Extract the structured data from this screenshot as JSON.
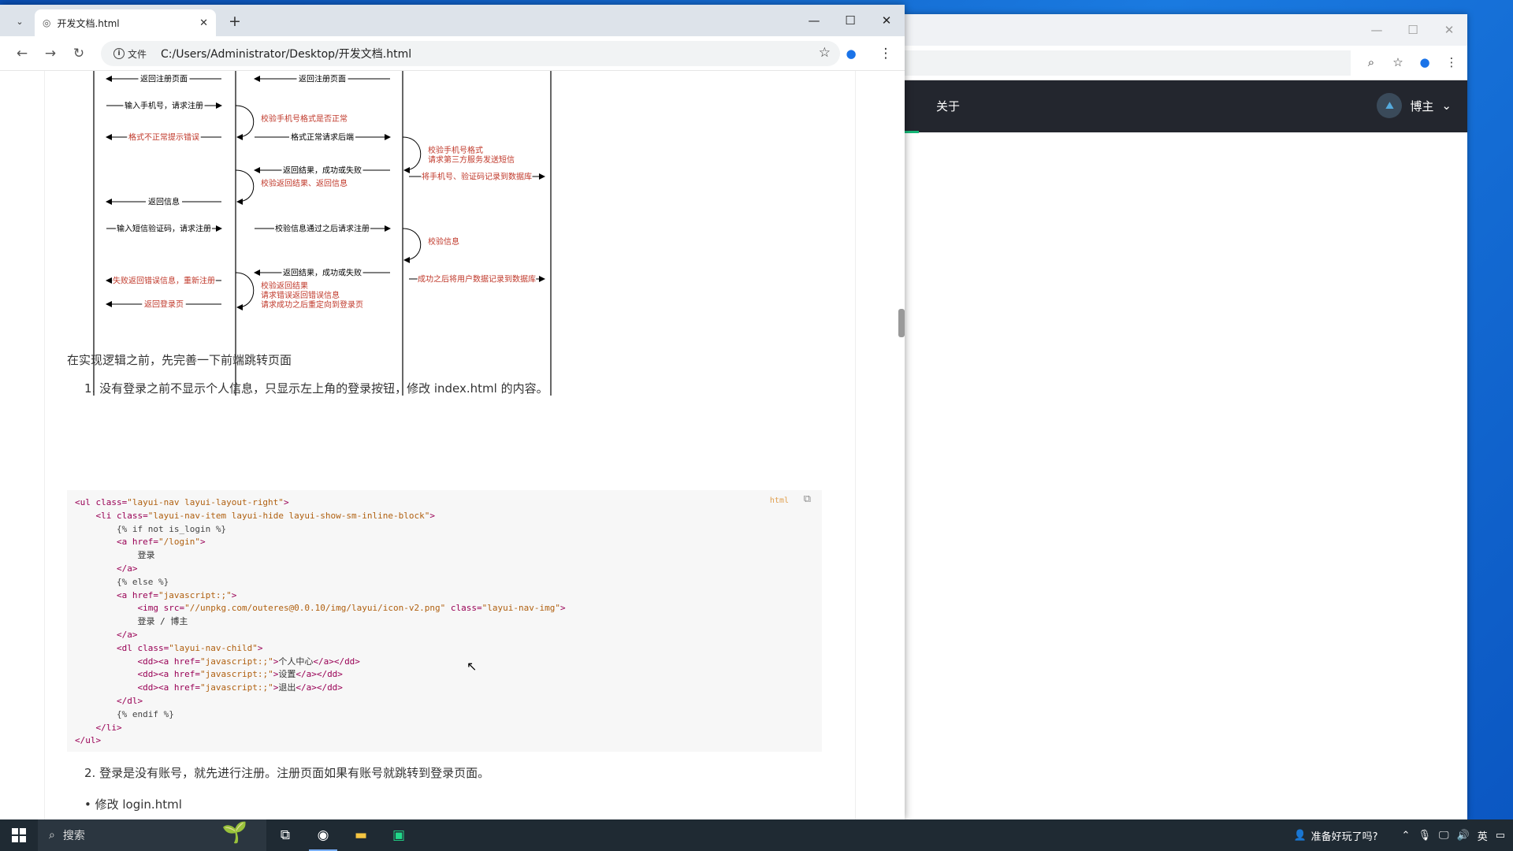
{
  "front_window": {
    "tab_title": "开发文档.html",
    "address_prefix": "文件",
    "url": "C:/Users/Administrator/Desktop/开发文档.html"
  },
  "back_window": {
    "nav_about": "关于",
    "user_label": "博主"
  },
  "diagram": {
    "col1": [
      {
        "text": "返回注册页面",
        "dir": "left",
        "color": "black"
      },
      {
        "text": "输入手机号，请求注册",
        "dir": "right",
        "color": "black"
      },
      {
        "text": "格式不正常提示错误",
        "dir": "left",
        "color": "red"
      },
      {
        "text": "返回信息",
        "dir": "left",
        "color": "black"
      },
      {
        "text": "输入短信验证码，请求注册",
        "dir": "right",
        "color": "black"
      },
      {
        "text": "失败返回错误信息，重新注册",
        "dir": "left",
        "color": "red"
      },
      {
        "text": "返回登录页",
        "dir": "left",
        "color": "red"
      }
    ],
    "col2": [
      {
        "text": "返回注册页面",
        "dir": "left",
        "color": "black"
      },
      {
        "text": "格式正常请求后端",
        "dir": "right",
        "color": "black"
      },
      {
        "text": "返回结果，成功或失败",
        "dir": "left",
        "color": "black"
      },
      {
        "text": "校验信息通过之后请求注册",
        "dir": "right",
        "color": "black"
      },
      {
        "text": "返回结果，成功或失败",
        "dir": "left",
        "color": "black"
      }
    ],
    "self_loops": [
      "校验手机号格式是否正常",
      "校验返回结果、返回信息",
      "校验返回结果",
      "请求错误返回错误信息",
      "请求成功之后重定向到登录页",
      "校验手机号格式",
      "请求第三方服务发送短信",
      "校验信息"
    ],
    "col3": [
      {
        "text": "将手机号、验证码记录到数据库",
        "dir": "right",
        "color": "red"
      },
      {
        "text": "成功之后将用户数据记录到数据库",
        "dir": "right",
        "color": "red"
      }
    ]
  },
  "content": {
    "intro": "在实现逻辑之前，先完善一下前端跳转页面",
    "item1": "1. 没有登录之前不显示个人信息，只显示左上角的登录按钮，修改 index.html 的内容。",
    "code_lang": "html",
    "item2": "2. 登录是没有账号，就先进行注册。注册页面如果有账号就跳转到登录页面。",
    "bullet1": "修改 login.html"
  },
  "taskbar": {
    "search_placeholder": "搜索",
    "tray_prompt": "准备好玩了吗?",
    "ime": "英"
  },
  "colors": {
    "accent_green": "#16b777",
    "red_text": "#c0392b"
  }
}
